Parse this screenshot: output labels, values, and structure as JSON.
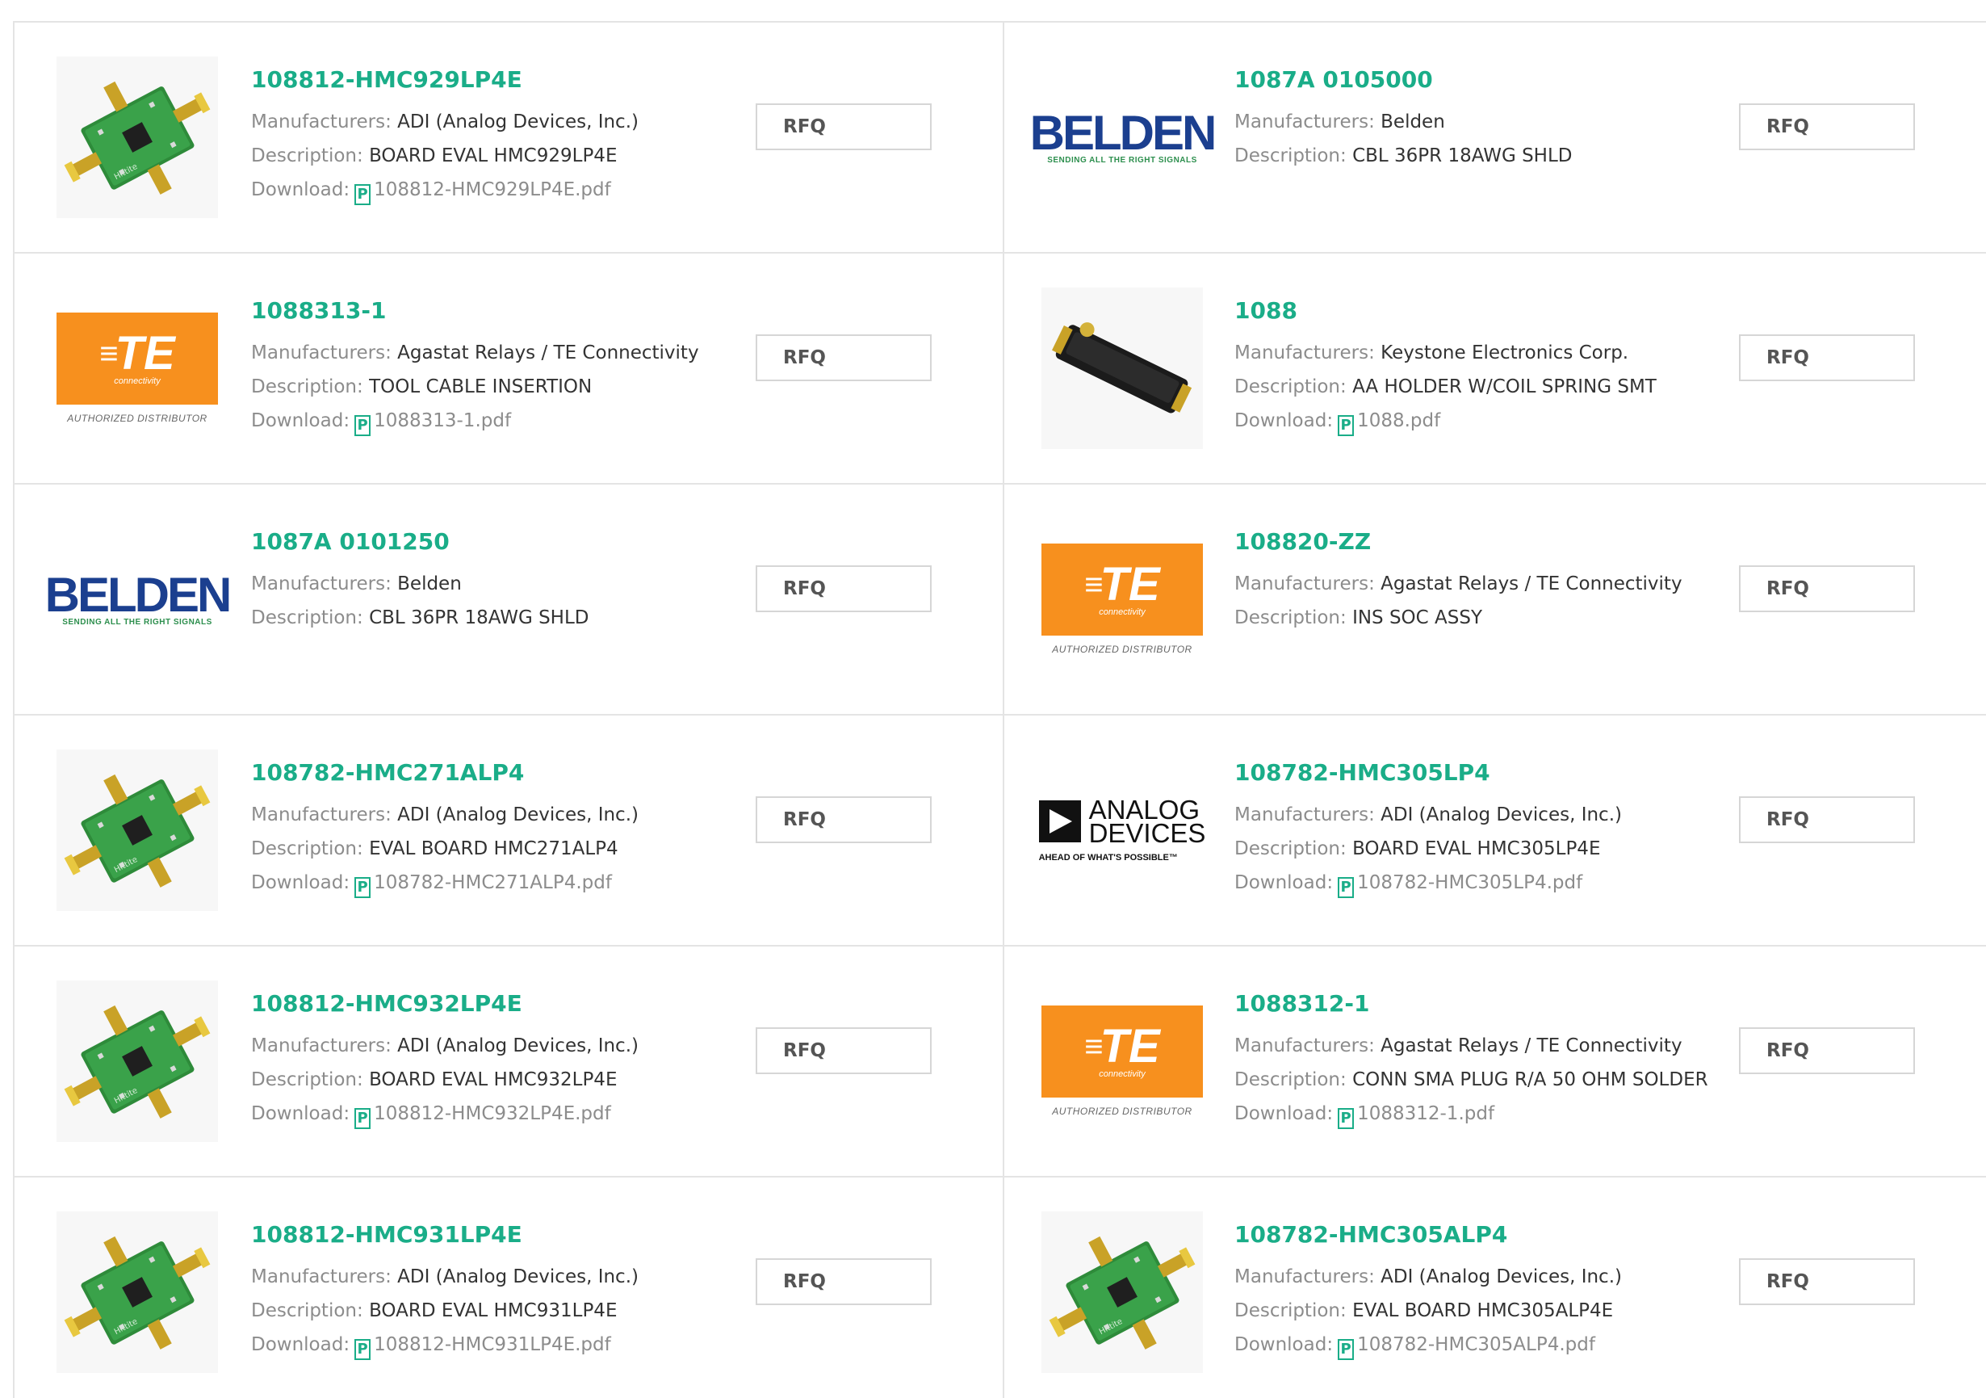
{
  "labels": {
    "manufacturers": "Manufacturers:",
    "description": "Description:",
    "download": "Download:",
    "rfq": "RFQ",
    "pdf_icon_glyph": "P"
  },
  "products": [
    {
      "part": "108812-HMC929LP4E",
      "manufacturer": "ADI (Analog Devices, Inc.)",
      "description": "BOARD EVAL HMC929LP4E",
      "download": "108812-HMC929LP4E.pdf",
      "image": "eval-board-icon"
    },
    {
      "part": "1087A 0105000",
      "manufacturer": "Belden",
      "description": "CBL 36PR 18AWG SHLD",
      "download": null,
      "image": "belden-logo"
    },
    {
      "part": "1088313-1",
      "manufacturer": "Agastat Relays / TE Connectivity",
      "description": "TOOL CABLE INSERTION",
      "download": "1088313-1.pdf",
      "image": "te-logo"
    },
    {
      "part": "1088",
      "manufacturer": "Keystone Electronics Corp.",
      "description": "AA HOLDER W/COIL SPRING SMT",
      "download": "1088.pdf",
      "image": "battery-holder-icon"
    },
    {
      "part": "1087A 0101250",
      "manufacturer": "Belden",
      "description": "CBL 36PR 18AWG SHLD",
      "download": null,
      "image": "belden-logo"
    },
    {
      "part": "108820-ZZ",
      "manufacturer": "Agastat Relays / TE Connectivity",
      "description": "INS SOC ASSY",
      "download": null,
      "image": "te-logo"
    },
    {
      "part": "108782-HMC271ALP4",
      "manufacturer": "ADI (Analog Devices, Inc.)",
      "description": "EVAL BOARD HMC271ALP4",
      "download": "108782-HMC271ALP4.pdf",
      "image": "eval-board-icon"
    },
    {
      "part": "108782-HMC305LP4",
      "manufacturer": "ADI (Analog Devices, Inc.)",
      "description": "BOARD EVAL HMC305LP4E",
      "download": "108782-HMC305LP4.pdf",
      "image": "analog-devices-logo"
    },
    {
      "part": "108812-HMC932LP4E",
      "manufacturer": "ADI (Analog Devices, Inc.)",
      "description": "BOARD EVAL HMC932LP4E",
      "download": "108812-HMC932LP4E.pdf",
      "image": "eval-board-icon"
    },
    {
      "part": "1088312-1",
      "manufacturer": "Agastat Relays / TE Connectivity",
      "description": "CONN SMA PLUG R/A 50 OHM SOLDER",
      "download": "1088312-1.pdf",
      "image": "te-logo"
    },
    {
      "part": "108812-HMC931LP4E",
      "manufacturer": "ADI (Analog Devices, Inc.)",
      "description": "BOARD EVAL HMC931LP4E",
      "download": "108812-HMC931LP4E.pdf",
      "image": "eval-board-icon"
    },
    {
      "part": "108782-HMC305ALP4",
      "manufacturer": "ADI (Analog Devices, Inc.)",
      "description": "EVAL BOARD HMC305ALP4E",
      "download": "108782-HMC305ALP4.pdf",
      "image": "eval-board-icon"
    }
  ],
  "logos": {
    "belden": {
      "word": "BELDEN",
      "tagline": "SENDING ALL THE RIGHT SIGNALS"
    },
    "te": {
      "mark": "TE",
      "sub": "connectivity",
      "dist": "AUTHORIZED DISTRIBUTOR"
    },
    "analog": {
      "line1": "ANALOG",
      "line2": "DEVICES",
      "tagline": "AHEAD OF WHAT'S POSSIBLE™"
    }
  },
  "colors": {
    "accent": "#1aad88",
    "label": "#8c8c8c",
    "border": "#e4e4e4",
    "te_orange": "#f7901e",
    "belden_blue": "#1b3f8f",
    "belden_green": "#2d8f4e"
  }
}
